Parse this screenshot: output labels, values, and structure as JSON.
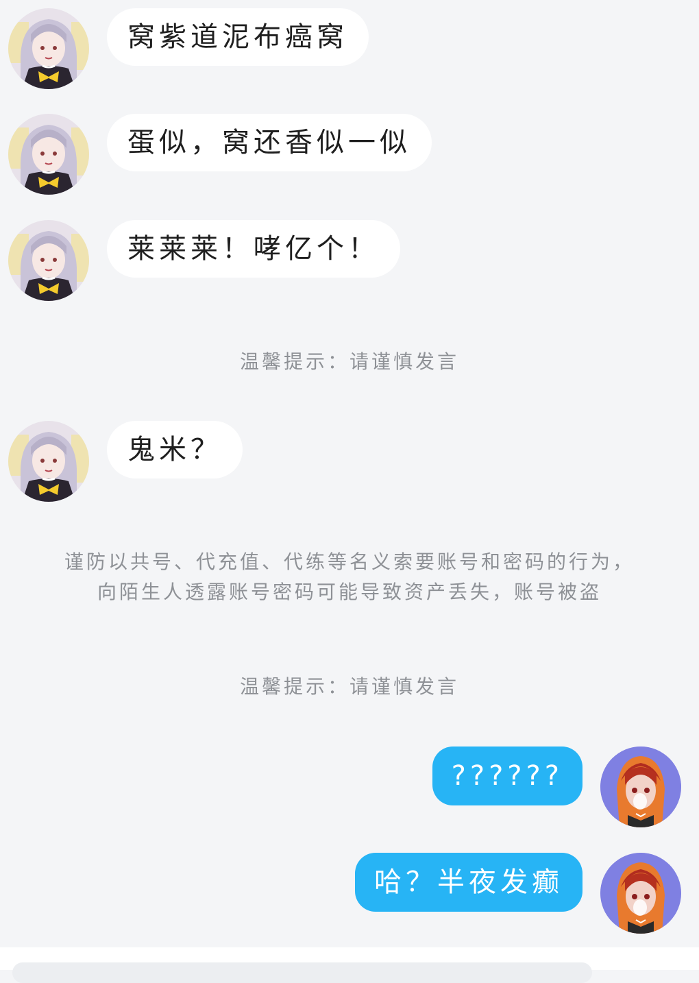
{
  "messages": [
    {
      "side": "left",
      "text": "窝紫道泥布癌窝"
    },
    {
      "side": "left",
      "text": "蛋似，窝还香似一似"
    },
    {
      "side": "left",
      "text": "莱莱莱！哮亿个！"
    },
    {
      "side": "left",
      "text": "鬼米？"
    },
    {
      "side": "right",
      "text": "??????"
    },
    {
      "side": "right",
      "text": "哈？半夜发癫"
    }
  ],
  "notices": {
    "tip1": "温馨提示：请谨慎发言",
    "warning_line1": "谨防以共号、代充值、代练等名义索要账号和密码的行为，",
    "warning_line2": "向陌生人透露账号密码可能导致资产丢失，账号被盗",
    "tip2": "温馨提示：请谨慎发言"
  },
  "colors": {
    "background": "#f4f5f7",
    "bubble_left": "#ffffff",
    "bubble_right": "#27b4f5",
    "notice_text": "#8e9196"
  }
}
